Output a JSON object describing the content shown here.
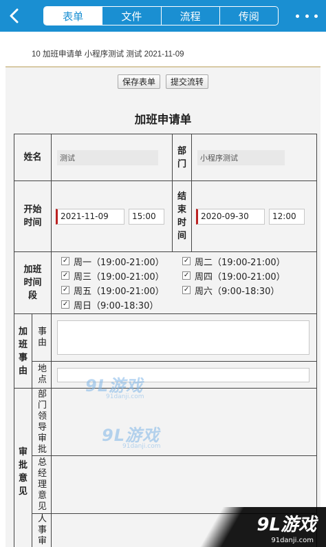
{
  "nav": {
    "tabs": [
      "表单",
      "文件",
      "流程",
      "传阅"
    ],
    "active_tab": 0
  },
  "doc_title": "10 加班申请单 小程序测试 测试 2021-11-09",
  "actions": {
    "save": "保存表单",
    "submit": "提交流转"
  },
  "form": {
    "title": "加班申请单",
    "name_label": "姓名",
    "name_value": "测试",
    "dept_label": "部门",
    "dept_value": "小程序测试",
    "start_label": "开始时间",
    "start_date": "2021-11-09",
    "start_time": "15:00",
    "end_label": "结束时间",
    "end_date": "2020-09-30",
    "end_time": "12:00",
    "period_label": "加班时间段",
    "periods": [
      "周一（19:00-21:00）",
      "周二（19:00-21:00）",
      "周三（19:00-21:00）",
      "周四（19:00-21:00）",
      "周五（19:00-21:00）",
      "周六（9:00-18:30）",
      "周日（9:00-18:30）"
    ],
    "reason_group_label": "加班事由",
    "reason_label": "事由",
    "location_label": "地点",
    "approval_label": "审批意见",
    "dept_leader_label": "部门领导审批",
    "gm_label": "总经理意见",
    "hr_label": "人事审"
  },
  "watermark": {
    "brand": "9L游戏",
    "url": "91danji.com"
  },
  "colors": {
    "nav_blue": "#1a8fd2",
    "required_marker": "#bb2222"
  }
}
